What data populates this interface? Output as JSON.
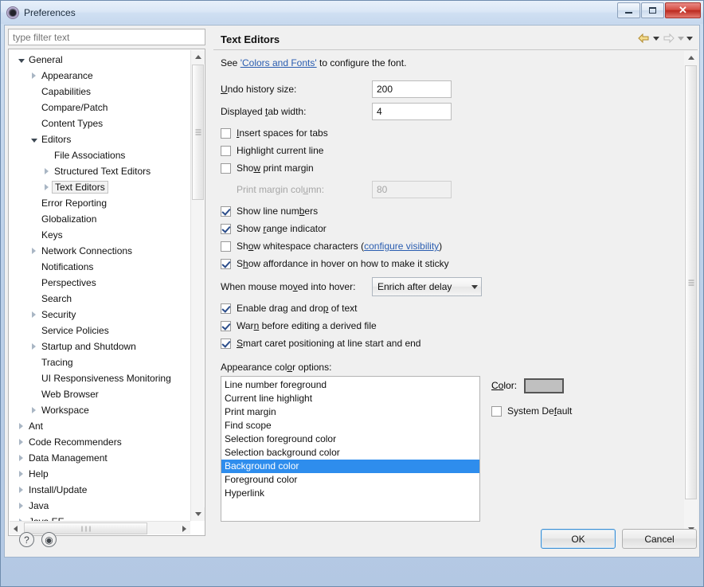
{
  "window": {
    "title": "Preferences",
    "icon": "preferences-icon",
    "minimize_label": "",
    "maximize_label": "",
    "close_label": "✕"
  },
  "sidebar": {
    "filter": {
      "placeholder": "type filter text",
      "value": ""
    },
    "items": [
      {
        "label": "General",
        "indent": 0,
        "arrow": "open",
        "selected": false
      },
      {
        "label": "Appearance",
        "indent": 1,
        "arrow": "closed",
        "selected": false
      },
      {
        "label": "Capabilities",
        "indent": 1,
        "arrow": "none",
        "selected": false
      },
      {
        "label": "Compare/Patch",
        "indent": 1,
        "arrow": "none",
        "selected": false
      },
      {
        "label": "Content Types",
        "indent": 1,
        "arrow": "none",
        "selected": false
      },
      {
        "label": "Editors",
        "indent": 1,
        "arrow": "open",
        "selected": false
      },
      {
        "label": "File Associations",
        "indent": 2,
        "arrow": "none",
        "selected": false
      },
      {
        "label": "Structured Text Editors",
        "indent": 2,
        "arrow": "closed",
        "selected": false
      },
      {
        "label": "Text Editors",
        "indent": 2,
        "arrow": "closed",
        "selected": true
      },
      {
        "label": "Error Reporting",
        "indent": 1,
        "arrow": "none",
        "selected": false
      },
      {
        "label": "Globalization",
        "indent": 1,
        "arrow": "none",
        "selected": false
      },
      {
        "label": "Keys",
        "indent": 1,
        "arrow": "none",
        "selected": false
      },
      {
        "label": "Network Connections",
        "indent": 1,
        "arrow": "closed",
        "selected": false
      },
      {
        "label": "Notifications",
        "indent": 1,
        "arrow": "none",
        "selected": false
      },
      {
        "label": "Perspectives",
        "indent": 1,
        "arrow": "none",
        "selected": false
      },
      {
        "label": "Search",
        "indent": 1,
        "arrow": "none",
        "selected": false
      },
      {
        "label": "Security",
        "indent": 1,
        "arrow": "closed",
        "selected": false
      },
      {
        "label": "Service Policies",
        "indent": 1,
        "arrow": "none",
        "selected": false
      },
      {
        "label": "Startup and Shutdown",
        "indent": 1,
        "arrow": "closed",
        "selected": false
      },
      {
        "label": "Tracing",
        "indent": 1,
        "arrow": "none",
        "selected": false
      },
      {
        "label": "UI Responsiveness Monitoring",
        "indent": 1,
        "arrow": "none",
        "selected": false
      },
      {
        "label": "Web Browser",
        "indent": 1,
        "arrow": "none",
        "selected": false
      },
      {
        "label": "Workspace",
        "indent": 1,
        "arrow": "closed",
        "selected": false
      },
      {
        "label": "Ant",
        "indent": 0,
        "arrow": "closed",
        "selected": false
      },
      {
        "label": "Code Recommenders",
        "indent": 0,
        "arrow": "closed",
        "selected": false
      },
      {
        "label": "Data Management",
        "indent": 0,
        "arrow": "closed",
        "selected": false
      },
      {
        "label": "Help",
        "indent": 0,
        "arrow": "closed",
        "selected": false
      },
      {
        "label": "Install/Update",
        "indent": 0,
        "arrow": "closed",
        "selected": false
      },
      {
        "label": "Java",
        "indent": 0,
        "arrow": "closed",
        "selected": false
      },
      {
        "label": "Java EE",
        "indent": 0,
        "arrow": "closed",
        "selected": false
      }
    ]
  },
  "page": {
    "title": "Text Editors",
    "nav": {
      "back_icon": "back-arrow-icon",
      "back_menu_icon": "chevron-down-icon",
      "forward_icon": "forward-arrow-icon",
      "forward_menu_icon": "chevron-down-icon",
      "menu_icon": "chevron-down-icon"
    },
    "intro": {
      "prefix": "See ",
      "link": "'Colors and Fonts'",
      "suffix": " to configure the font."
    },
    "fields": [
      {
        "label_pre": "",
        "label_mnemonic": "U",
        "label_post": "ndo history size:",
        "value": "200",
        "enabled": true
      },
      {
        "label_pre": "Displayed ",
        "label_mnemonic": "t",
        "label_post": "ab width:",
        "value": "4",
        "enabled": true
      }
    ],
    "checkboxes_top": [
      {
        "pre": "",
        "mnemonic": "I",
        "post": "nsert spaces for tabs",
        "checked": false,
        "enabled": true
      },
      {
        "pre": "Hi",
        "mnemonic": "g",
        "post": "hlight current line",
        "checked": false,
        "enabled": true
      },
      {
        "pre": "Sho",
        "mnemonic": "w",
        "post": " print margin",
        "checked": false,
        "enabled": true
      }
    ],
    "print_margin": {
      "label_pre": "Print margin col",
      "label_mnemonic": "u",
      "label_post": "mn:",
      "value": "80",
      "enabled": false
    },
    "checkboxes_mid": [
      {
        "pre": "Show line num",
        "mnemonic": "b",
        "post": "ers",
        "checked": true,
        "enabled": true
      },
      {
        "pre": "Show ",
        "mnemonic": "r",
        "post": "ange indicator",
        "checked": true,
        "enabled": true
      }
    ],
    "whitespace": {
      "pre": "Sh",
      "mnemonic": "o",
      "post": "w whitespace characters ",
      "link_open": "(",
      "link": "configure visibility",
      "link_close": ")",
      "checked": false
    },
    "affordance": {
      "pre": "S",
      "mnemonic": "h",
      "post": "ow affordance in hover on how to make it sticky",
      "checked": true
    },
    "hover": {
      "label_pre": "When mouse mo",
      "label_mnemonic": "v",
      "label_post": "ed into hover:",
      "value": "Enrich after delay",
      "dropdown_icon": "chevron-down-icon",
      "options": [
        "Enrich after delay"
      ]
    },
    "checkboxes_bottom": [
      {
        "pre": "Enable drag and dro",
        "mnemonic": "p",
        "post": " of text",
        "checked": true
      },
      {
        "pre": "War",
        "mnemonic": "n",
        "post": " before editing a derived file",
        "checked": true
      },
      {
        "pre": "",
        "mnemonic": "S",
        "post": "mart caret positioning at line start and end",
        "checked": true
      }
    ],
    "appearance": {
      "label_pre": "Appearance col",
      "label_mnemonic": "o",
      "label_post": "r options:",
      "items": [
        {
          "label": "Line number foreground",
          "selected": false
        },
        {
          "label": "Current line highlight",
          "selected": false
        },
        {
          "label": "Print margin",
          "selected": false
        },
        {
          "label": "Find scope",
          "selected": false
        },
        {
          "label": "Selection foreground color",
          "selected": false
        },
        {
          "label": "Selection background color",
          "selected": false
        },
        {
          "label": "Background color",
          "selected": true
        },
        {
          "label": "Foreground color",
          "selected": false
        },
        {
          "label": "Hyperlink",
          "selected": false
        }
      ],
      "selection_color": "#2e8ded"
    },
    "color_panel": {
      "label_pre": "C",
      "label_mnemonic": "o",
      "label_post": "lor:",
      "swatch_color": "#c0c0c0",
      "system_default": {
        "pre": "System De",
        "mnemonic": "f",
        "post": "ault",
        "checked": false
      }
    }
  },
  "footer": {
    "help_icon": "?",
    "secondary_icon": "◉",
    "ok_label": "OK",
    "cancel_label": "Cancel"
  }
}
